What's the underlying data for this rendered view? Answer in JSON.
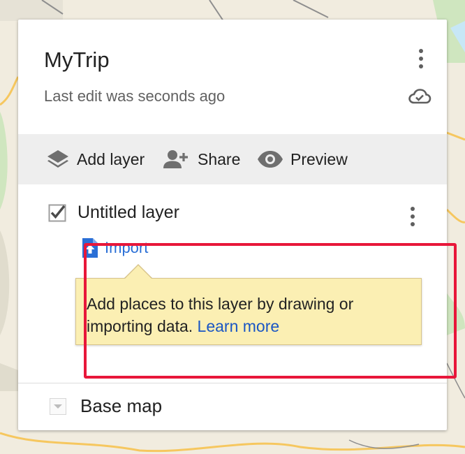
{
  "map": {
    "water_color": "#c7e7f6",
    "park_color": "#cfe6bf",
    "road_color": "#f6c75f"
  },
  "header": {
    "title": "MyTrip",
    "subtitle": "Last edit was seconds ago",
    "menu_icon": "more-vert-icon",
    "cloud_icon": "cloud-saved-icon"
  },
  "toolbar": {
    "add_layer": {
      "label": "Add layer",
      "icon": "layers-icon"
    },
    "share": {
      "label": "Share",
      "icon": "person-add-icon"
    },
    "preview": {
      "label": "Preview",
      "icon": "eye-icon"
    }
  },
  "layer": {
    "name": "Untitled layer",
    "checked": true,
    "import_label": "Import",
    "import_icon": "file-upload-icon",
    "tooltip_text": "Add places to this layer by drawing or importing data.",
    "tooltip_link": "Learn more"
  },
  "highlight_color": "#e8173a",
  "basemap": {
    "label": "Base map",
    "icon": "dropdown-arrow-icon"
  }
}
